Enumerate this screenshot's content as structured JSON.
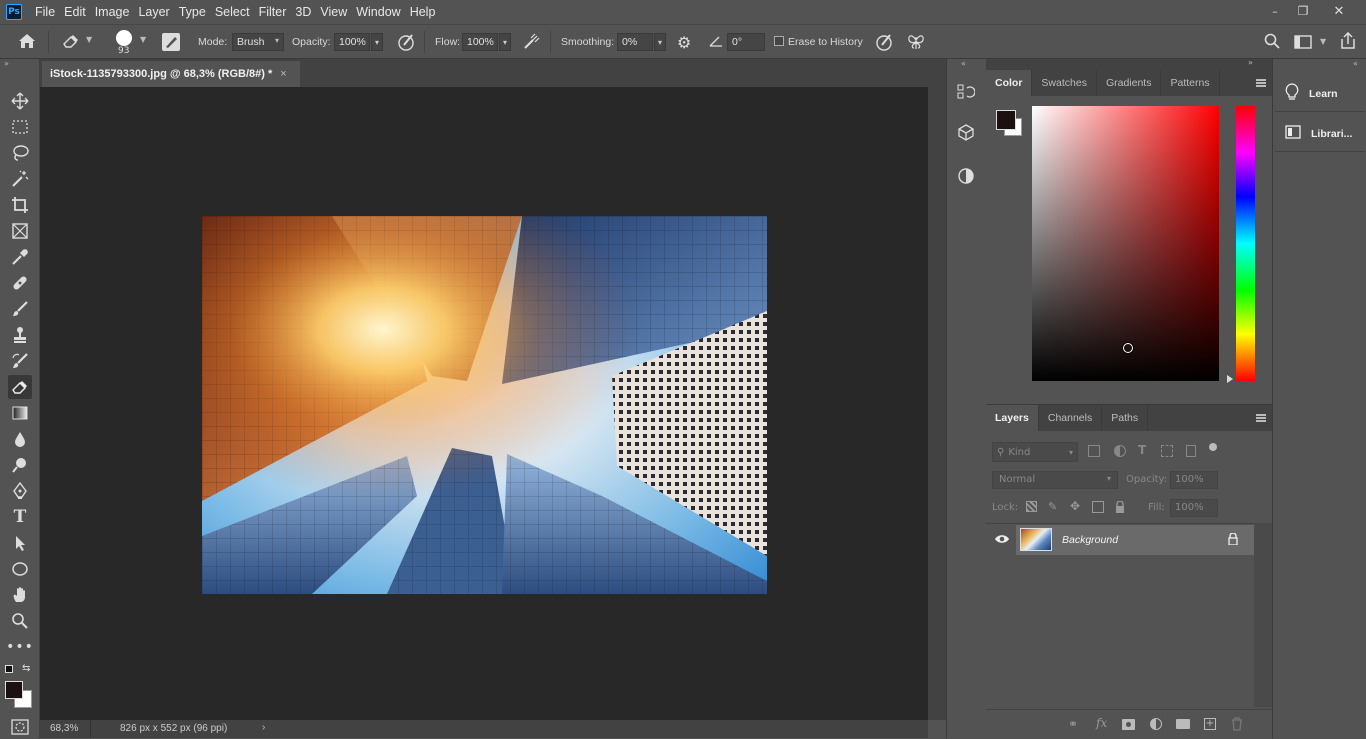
{
  "app": {
    "logo": "Ps"
  },
  "menu": [
    "File",
    "Edit",
    "Image",
    "Layer",
    "Type",
    "Select",
    "Filter",
    "3D",
    "View",
    "Window",
    "Help"
  ],
  "window_controls": {
    "minimize": "–",
    "restore": "❐",
    "close": "✕"
  },
  "options": {
    "brush_size": "93",
    "mode_label": "Mode:",
    "mode_value": "Brush",
    "opacity_label": "Opacity:",
    "opacity_value": "100%",
    "flow_label": "Flow:",
    "flow_value": "100%",
    "smoothing_label": "Smoothing:",
    "smoothing_value": "0%",
    "angle_value": "0°",
    "erase_history_label": "Erase to History"
  },
  "document": {
    "tab_title": "iStock-1135793300.jpg @ 68,3% (RGB/8#) *",
    "zoom": "68,3%",
    "info": "826 px x 552 px (96 ppi)"
  },
  "color_panel": {
    "tabs": [
      "Color",
      "Swatches",
      "Gradients",
      "Patterns"
    ],
    "foreground": "#1c1010",
    "background": "#ffffff",
    "hue_color": "#ff0000"
  },
  "layers_panel": {
    "tabs": [
      "Layers",
      "Channels",
      "Paths"
    ],
    "filter_placeholder": "Kind",
    "blend_mode": "Normal",
    "opacity_label": "Opacity:",
    "opacity_value": "100%",
    "lock_label": "Lock:",
    "fill_label": "Fill:",
    "fill_value": "100%",
    "layers": [
      {
        "name": "Background",
        "visible": true,
        "locked": true
      }
    ]
  },
  "right_dock": [
    {
      "label": "Learn",
      "icon": "lightbulb-icon"
    },
    {
      "label": "Librari...",
      "icon": "libraries-icon"
    }
  ]
}
